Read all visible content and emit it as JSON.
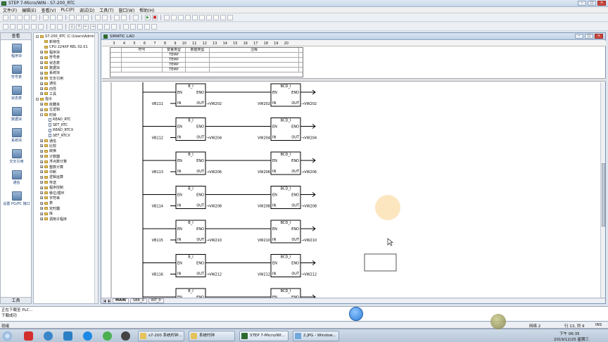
{
  "window": {
    "title": "STEP 7-Micro/WIN - S7-200_RTC"
  },
  "menu": [
    "文件(F)",
    "编辑(E)",
    "查看(V)",
    "PLC(P)",
    "调试(D)",
    "工具(T)",
    "窗口(W)",
    "帮助(H)"
  ],
  "navbar": {
    "header": "查看",
    "footer": "工具",
    "items": [
      "程序块",
      "符号表",
      "状态表",
      "数据块",
      "系统块",
      "交叉引用",
      "通信",
      "设置 PG/PC 接口"
    ]
  },
  "tree": {
    "nodes": [
      {
        "text": "S7-200_RTC (C:\\Users\\Administr",
        "level": 0,
        "exp": "-"
      },
      {
        "text": "新特性",
        "level": 1,
        "exp": ""
      },
      {
        "text": "CPU 224XP REL 02.01",
        "level": 1,
        "exp": ""
      },
      {
        "text": "程序块",
        "level": 1,
        "exp": "+"
      },
      {
        "text": "符号表",
        "level": 1,
        "exp": "+"
      },
      {
        "text": "状态表",
        "level": 1,
        "exp": "+"
      },
      {
        "text": "数据块",
        "level": 1,
        "exp": "+"
      },
      {
        "text": "系统块",
        "level": 1,
        "exp": "+"
      },
      {
        "text": "交叉引用",
        "level": 1,
        "exp": "+"
      },
      {
        "text": "通信",
        "level": 1,
        "exp": "+"
      },
      {
        "text": "向导",
        "level": 1,
        "exp": "+"
      },
      {
        "text": "工具",
        "level": 1,
        "exp": "+"
      },
      {
        "text": "指令",
        "level": 0,
        "exp": "-"
      },
      {
        "text": "收藏夹",
        "level": 1,
        "exp": "+"
      },
      {
        "text": "位逻辑",
        "level": 1,
        "exp": "+"
      },
      {
        "text": "时钟",
        "level": 1,
        "exp": "-"
      },
      {
        "text": "READ_RTC",
        "level": 2,
        "exp": ""
      },
      {
        "text": "SET_RTC",
        "level": 2,
        "exp": ""
      },
      {
        "text": "READ_RTCX",
        "level": 2,
        "exp": ""
      },
      {
        "text": "SET_RTCX",
        "level": 2,
        "exp": ""
      },
      {
        "text": "通信",
        "level": 1,
        "exp": "+"
      },
      {
        "text": "比较",
        "level": 1,
        "exp": "+"
      },
      {
        "text": "转换",
        "level": 1,
        "exp": "+"
      },
      {
        "text": "计数器",
        "level": 1,
        "exp": "+"
      },
      {
        "text": "浮点数计算",
        "level": 1,
        "exp": "+"
      },
      {
        "text": "整数计算",
        "level": 1,
        "exp": "+"
      },
      {
        "text": "中断",
        "level": 1,
        "exp": "+"
      },
      {
        "text": "逻辑运算",
        "level": 1,
        "exp": "+"
      },
      {
        "text": "传送",
        "level": 1,
        "exp": "+"
      },
      {
        "text": "程序控制",
        "level": 1,
        "exp": "+"
      },
      {
        "text": "移位/循环",
        "level": 1,
        "exp": "+"
      },
      {
        "text": "字符串",
        "level": 1,
        "exp": "+"
      },
      {
        "text": "表",
        "level": 1,
        "exp": "+"
      },
      {
        "text": "定时器",
        "level": 1,
        "exp": "+"
      },
      {
        "text": "库",
        "level": 1,
        "exp": "+"
      },
      {
        "text": "调用子程序",
        "level": 1,
        "exp": "+"
      }
    ]
  },
  "editor": {
    "title": "SIMATIC LAD",
    "ruler": [
      "3",
      "4",
      "5",
      "6",
      "7",
      "8",
      "9",
      "10",
      "11",
      "12",
      "13",
      "14",
      "15",
      "16",
      "17",
      "18",
      "19",
      "20"
    ],
    "var_headers": [
      "符号",
      "变量类型",
      "数据类型",
      "注释"
    ],
    "var_rows": [
      "TEMP",
      "TEMP",
      "TEMP",
      "TEMP"
    ],
    "tabs": [
      "MAIN",
      "SBR_0",
      "INT_0"
    ],
    "rungs": [
      {
        "b_title": "B_I",
        "in": "VB111",
        "out_mid": "VW202",
        "bcd_title": "BCD_I",
        "in2": "VW202",
        "out2": "VW202"
      },
      {
        "b_title": "B_I",
        "in": "VB112",
        "out_mid": "VW204",
        "bcd_title": "BCD_I",
        "in2": "VW204",
        "out2": "VW204"
      },
      {
        "b_title": "B_I",
        "in": "VB113",
        "out_mid": "VW206",
        "bcd_title": "BCD_I",
        "in2": "VW206",
        "out2": "VW206"
      },
      {
        "b_title": "B_I",
        "in": "VB114",
        "out_mid": "VW208",
        "bcd_title": "BCD_I",
        "in2": "VW208",
        "out2": "VW208"
      },
      {
        "b_title": "B_I",
        "in": "VB115",
        "out_mid": "VW210",
        "bcd_title": "BCD_I",
        "in2": "VW210",
        "out2": "VW210"
      },
      {
        "b_title": "B_I",
        "in": "VB116",
        "out_mid": "VW212",
        "bcd_title": "BCD_I",
        "in2": "VW212",
        "out2": "VW212"
      },
      {
        "b_title": "B_I",
        "in": "",
        "out_mid": "",
        "bcd_title": "BCD_I",
        "in2": "",
        "out2": ""
      }
    ],
    "pins": {
      "en": "EN",
      "eno": "ENO",
      "in": "IN",
      "out": "OUT"
    }
  },
  "output": {
    "line1": "正在下载至 PLC...",
    "line2": "下载成功"
  },
  "status": {
    "left": "就绪",
    "net": "网络 2",
    "rowcol": "行 13, 列 9",
    "mode": "INS"
  },
  "taskbar": {
    "buttons": [
      "s7-200 系统时钟...",
      "系统时钟",
      "STEP 7-Micro/WI...",
      "2.JPG - Window..."
    ],
    "time": "下午 06:35",
    "date": "2019/12/25 星期三"
  }
}
